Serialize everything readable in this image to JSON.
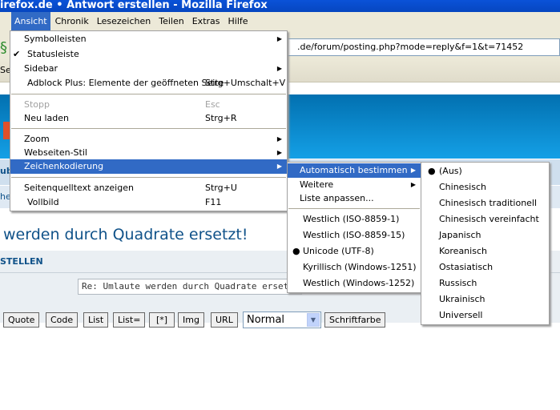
{
  "window": {
    "title": "irefox.de • Antwort erstellen - Mozilla Firefox"
  },
  "menubar": [
    "Ansicht",
    "Chronik",
    "Lesezeichen",
    "Teilen",
    "Extras",
    "Hilfe"
  ],
  "url": ".de/forum/posting.php?mode=reply&f=1&t=71452",
  "left_fragments": {
    "bookmark": "Sei",
    "strip1": "ub",
    "strip2": "he"
  },
  "view_menu": {
    "items": [
      {
        "label": "Symbolleisten",
        "submenu": true
      },
      {
        "label": "Statusleiste",
        "checked": true
      },
      {
        "label": "Sidebar",
        "submenu": true
      },
      {
        "label": "Adblock Plus: Elemente der geöffneten Seite",
        "shortcut": "Strg+Umschalt+V"
      },
      {
        "label": "Stopp",
        "shortcut": "Esc",
        "disabled": true
      },
      {
        "label": "Neu laden",
        "shortcut": "Strg+R"
      },
      {
        "label": "Zoom",
        "submenu": true
      },
      {
        "label": "Webseiten-Stil",
        "submenu": true
      },
      {
        "label": "Zeichenkodierung",
        "submenu": true,
        "highlighted": true
      },
      {
        "label": "Seitenquelltext anzeigen",
        "shortcut": "Strg+U"
      },
      {
        "label": "Vollbild",
        "shortcut": "F11"
      }
    ]
  },
  "encoding_menu": {
    "items": [
      "Automatisch bestimmen",
      "Weitere",
      "Liste anpassen...",
      "Westlich (ISO-8859-1)",
      "Westlich (ISO-8859-15)",
      "Unicode (UTF-8)",
      "Kyrillisch (Windows-1251)",
      "Westlich (Windows-1252)"
    ],
    "selected": "Unicode (UTF-8)"
  },
  "auto_menu": {
    "items": [
      "(Aus)",
      "Chinesisch",
      "Chinesisch traditionell",
      "Chinesisch vereinfacht",
      "Japanisch",
      "Koreanisch",
      "Ostasiatisch",
      "Russisch",
      "Ukrainisch",
      "Universell"
    ],
    "selected": "(Aus)"
  },
  "page": {
    "heading": "werden durch Quadrate ersetzt!",
    "section_title": "STELLEN",
    "subject": "Re: Umlaute werden durch Quadrate ersetzt",
    "buttons": [
      "Quote",
      "Code",
      "List",
      "List=",
      "[*]",
      "Img",
      "URL"
    ],
    "font_size": "Normal",
    "font_color": "Schriftfarbe"
  },
  "colors": {
    "highlight": "#316ac5",
    "titlebar": "#0a52d8",
    "heading": "#105289"
  }
}
